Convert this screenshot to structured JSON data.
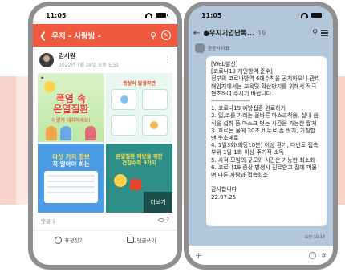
{
  "left_phone": {
    "time": "11:05",
    "header": {
      "title": "우지 - 사랑방 -"
    },
    "post": {
      "author": "김시원",
      "date": "2022년 7월 28일 오후 5:51",
      "tiles": {
        "t1_headline": "폭염 속\n온열질환",
        "t1_sub": "이렇게 대처하세요!",
        "t2_title": "증상이 발생하면",
        "t3_title_a": "다섯 가지 정보",
        "t3_title_b": "꼭 알아야 하는",
        "t4_title": "온열질환 예방을 위한\n건강수칙 3가지",
        "more_label": "더보기"
      },
      "comments": "댓글 1",
      "views": "7"
    },
    "actions": {
      "emotion": "표정짓기",
      "comment": "댓글쓰기"
    }
  },
  "right_phone": {
    "time": "11:05",
    "chat": {
      "title": "●우지기업단톡...",
      "count": "19"
    },
    "sender": "관광식 대표",
    "message": "[Web발신]\n[코로나19 개인방역 준수]\n정부의 코로나방역 6대수칙을 공지하오니 관리해임지께서는 교육및 확산방지를 위해서 적극 협조하여 주시기 바랍니다.\n-------------------\n1. 코로나19 예방접종 완료하기\n2. 입,코를 가리는 올바른 마스크착용, 실내 음식을 섭취 등 마스크 벗는 시간은 가능한 짧게\n3. 흐르는 물에 30초 비누로 손 씻기, 기침할 땐 옷소매로\n4. 1일3회(회당10분) 이상 환기, 다빈도 접촉부위 1일 1회 이상 주기적 소독\n5. 사적 모임의 규모와 시간은 가능한 최소화\n6. 코로나19 증상 발생시 진료받고 집에 머물며 다른 사람과 접촉최소\n\n감사합니다\n22.07.25",
    "time_label": "오전 10:17"
  }
}
